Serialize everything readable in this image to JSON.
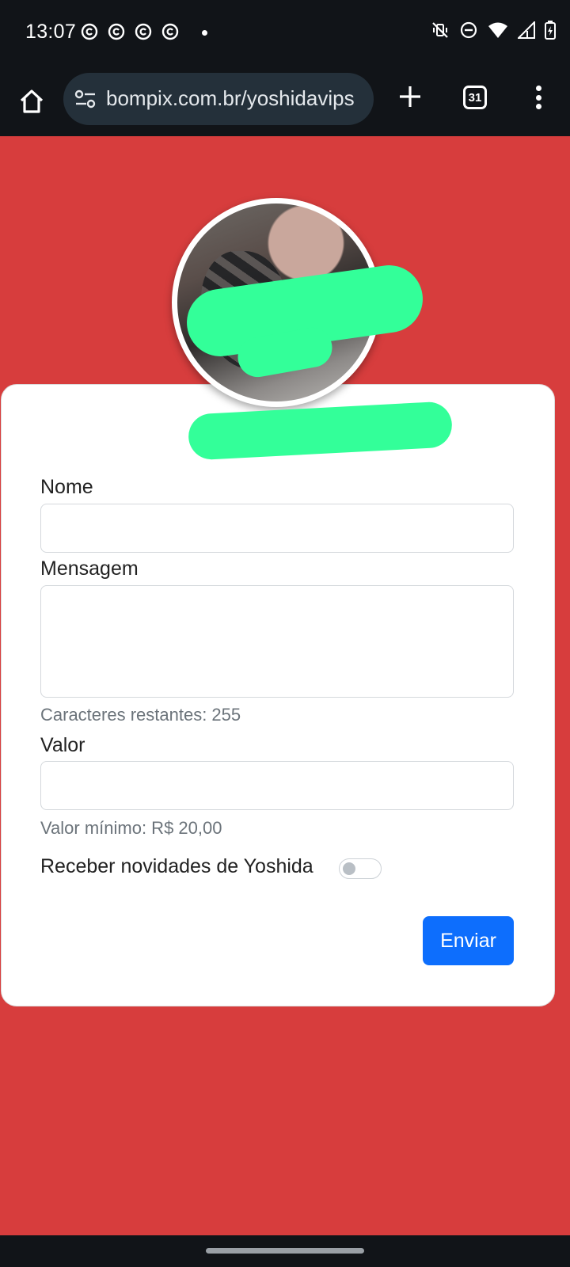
{
  "status_bar": {
    "time": "13:07"
  },
  "browser": {
    "url": "bompix.com.br/yoshidavips",
    "tab_count": "31"
  },
  "form": {
    "name_label": "Nome",
    "message_label": "Mensagem",
    "chars_remaining": "Caracteres restantes: 255",
    "value_label": "Valor",
    "min_value": "Valor mínimo: R$ 20,00",
    "newsletter_label": "Receber novidades de Yoshida",
    "newsletter_enabled": false,
    "submit_label": "Enviar"
  },
  "colors": {
    "page_background": "#d73d3d",
    "accent": "#0d6efd",
    "redaction": "#33ff99"
  }
}
